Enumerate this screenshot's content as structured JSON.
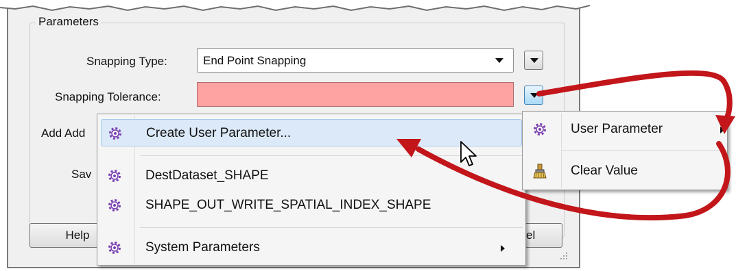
{
  "group": {
    "title": "Parameters"
  },
  "fields": {
    "snapping_type_label": "Snapping Type:",
    "snapping_type_value": "End Point Snapping",
    "snapping_tolerance_label": "Snapping Tolerance:",
    "snapping_tolerance_value": "",
    "add_label_partial": "Add Add",
    "save_label_partial": "Sav"
  },
  "buttons": {
    "help_label": "Help",
    "cancel_label_partial": "el"
  },
  "main_menu": {
    "items": [
      {
        "label": "Create User Parameter...",
        "icon": "gear-icon",
        "highlighted": true
      },
      {
        "label": "DestDataset_SHAPE",
        "icon": "gear-icon"
      },
      {
        "label": "SHAPE_OUT_WRITE_SPATIAL_INDEX_SHAPE",
        "icon": "gear-icon"
      },
      {
        "label": "System Parameters",
        "icon": "gear-icon",
        "submenu": true
      }
    ]
  },
  "context_menu": {
    "items": [
      {
        "label": "User Parameter",
        "icon": "gear-icon",
        "submenu": true
      },
      {
        "label": "Clear Value",
        "icon": "broom-icon"
      }
    ]
  },
  "colors": {
    "tolerance_error_fill": "#ffa2a2",
    "menu_highlight": "#dce9f8",
    "arrow_red": "#c2161b",
    "gear_purple": "#7a3fb0"
  }
}
